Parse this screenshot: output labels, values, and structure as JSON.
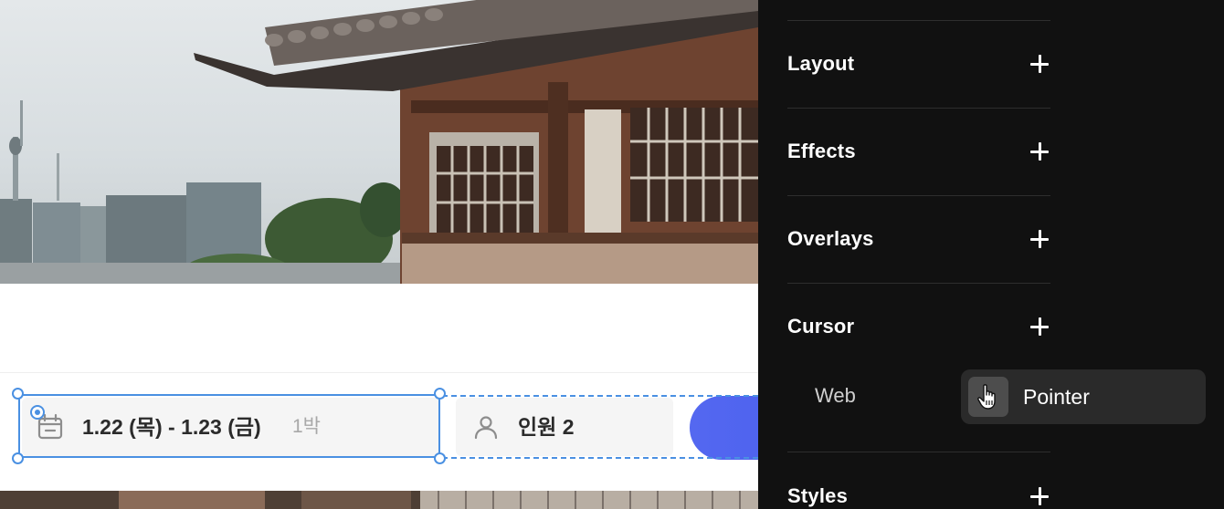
{
  "canvas": {
    "booking": {
      "date_range": "1.22 (목) - 1.23 (금)",
      "nights": "1박",
      "guests": "인원 2"
    },
    "selection_color": "#4a90e2",
    "button_color": "#5468f0"
  },
  "panel": {
    "sections": [
      {
        "title": "Layout",
        "icon": "plus-icon"
      },
      {
        "title": "Effects",
        "icon": "plus-icon"
      },
      {
        "title": "Overlays",
        "icon": "plus-icon"
      },
      {
        "title": "Cursor",
        "icon": "plus-icon"
      },
      {
        "title": "Styles",
        "icon": "plus-icon"
      }
    ],
    "cursor": {
      "web_label": "Web",
      "value": "Pointer",
      "icon": "hand-pointer-icon"
    },
    "background_color": "#111111"
  }
}
